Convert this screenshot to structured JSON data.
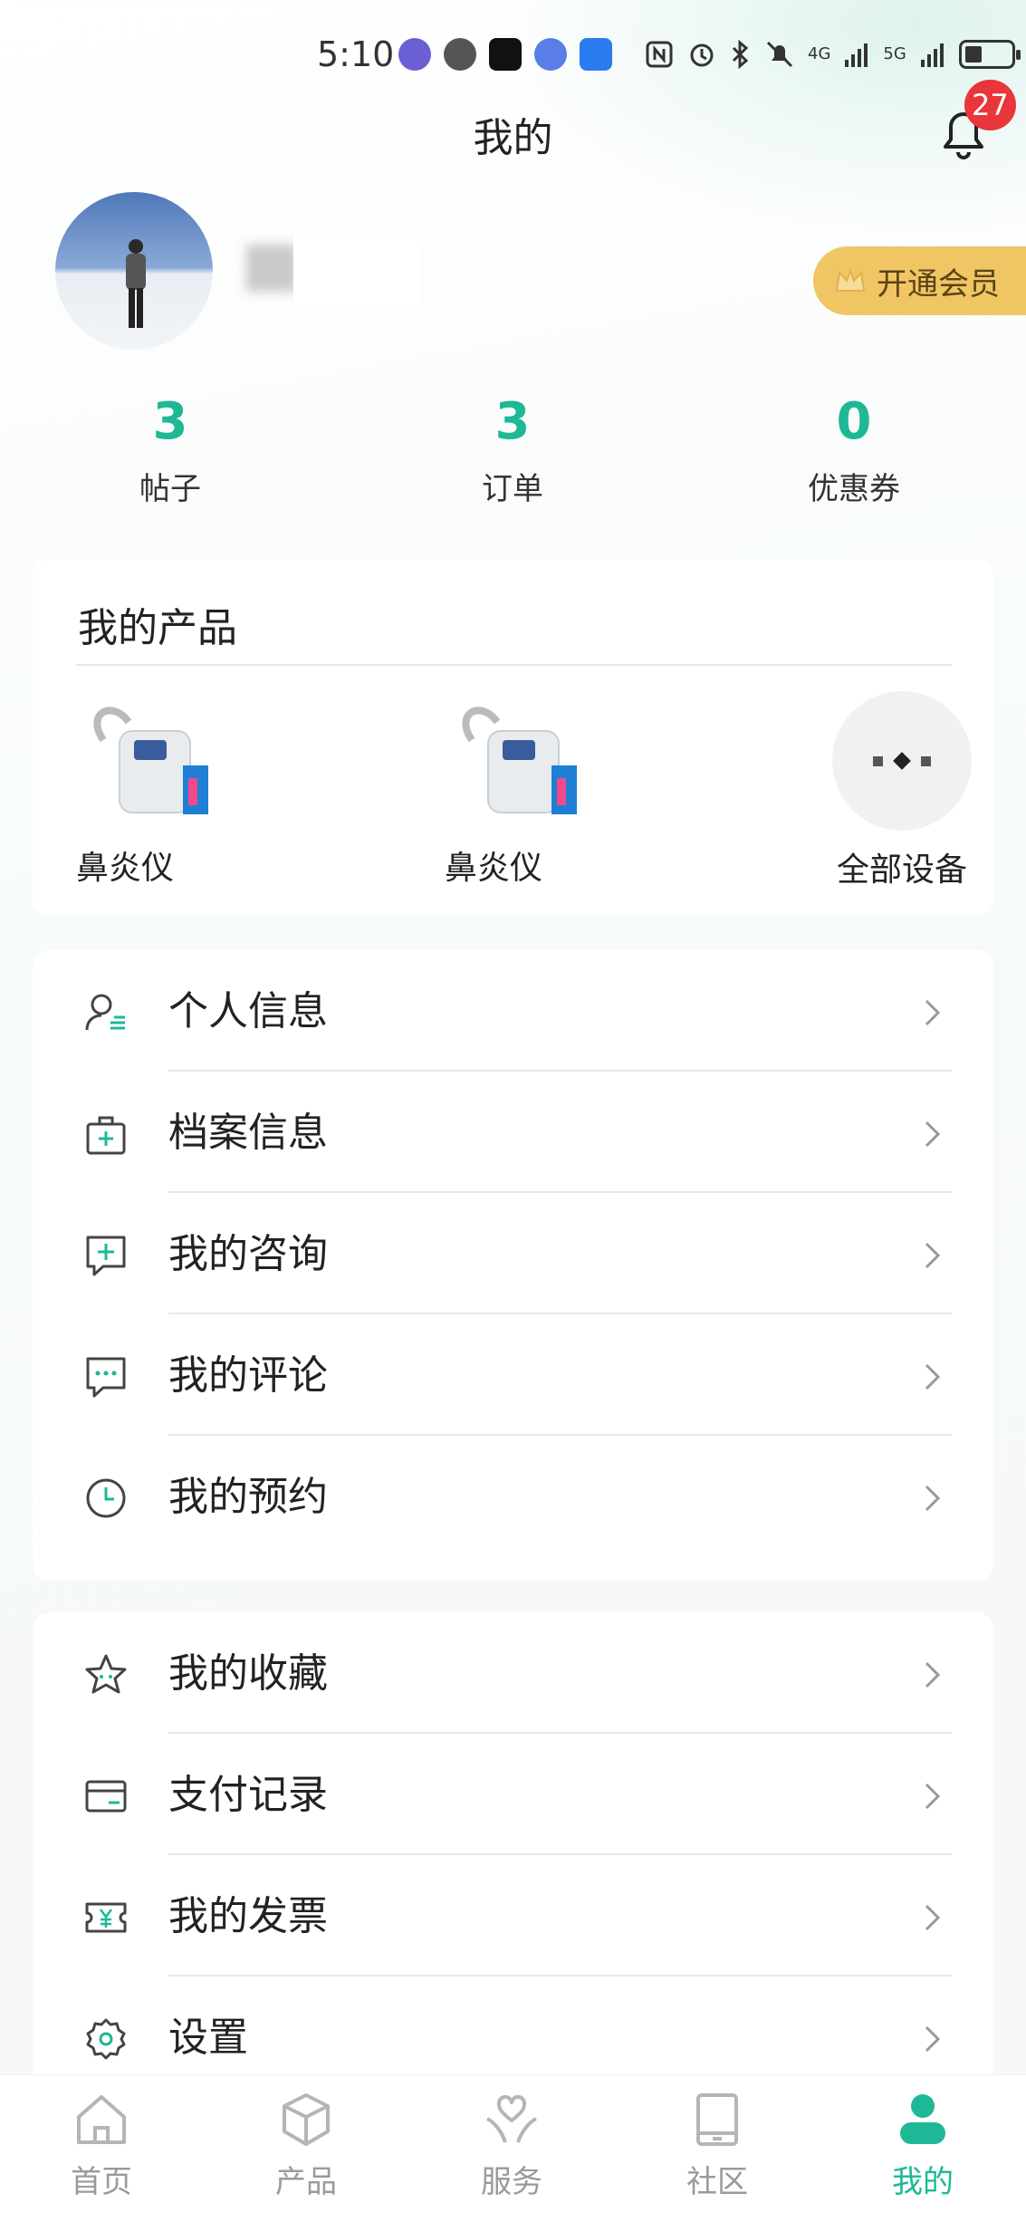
{
  "status_bar": {
    "time": "5:10",
    "indicators": [
      "nfc-icon",
      "alarm-icon",
      "bluetooth-icon",
      "mute-icon"
    ],
    "network_1": "4G",
    "network_2": "5G"
  },
  "header": {
    "title": "我的",
    "notification_count": "27"
  },
  "profile": {
    "vip_label": "开通会员"
  },
  "stats": [
    {
      "value": "3",
      "label": "帖子"
    },
    {
      "value": "3",
      "label": "订单"
    },
    {
      "value": "0",
      "label": "优惠券"
    }
  ],
  "products": {
    "title": "我的产品",
    "items": [
      {
        "name": "鼻炎仪"
      },
      {
        "name": "鼻炎仪"
      }
    ],
    "all_devices_label": "全部设备"
  },
  "menu_group_1": [
    {
      "label": "个人信息",
      "icon": "person-icon"
    },
    {
      "label": "档案信息",
      "icon": "medical-kit-icon"
    },
    {
      "label": "我的咨询",
      "icon": "consult-icon"
    },
    {
      "label": "我的评论",
      "icon": "comment-icon"
    },
    {
      "label": "我的预约",
      "icon": "clock-icon"
    }
  ],
  "menu_group_2": [
    {
      "label": "我的收藏",
      "icon": "star-icon"
    },
    {
      "label": "支付记录",
      "icon": "card-icon"
    },
    {
      "label": "我的发票",
      "icon": "invoice-icon"
    },
    {
      "label": "设置",
      "icon": "gear-icon"
    }
  ],
  "tabbar": [
    {
      "label": "首页",
      "icon": "home-icon"
    },
    {
      "label": "产品",
      "icon": "box-icon"
    },
    {
      "label": "服务",
      "icon": "service-icon"
    },
    {
      "label": "社区",
      "icon": "tablet-icon"
    },
    {
      "label": "我的",
      "icon": "user-icon",
      "active": true
    }
  ],
  "colors": {
    "accent": "#1eb896",
    "badge": "#e8363b",
    "vip": "#f0c564"
  }
}
